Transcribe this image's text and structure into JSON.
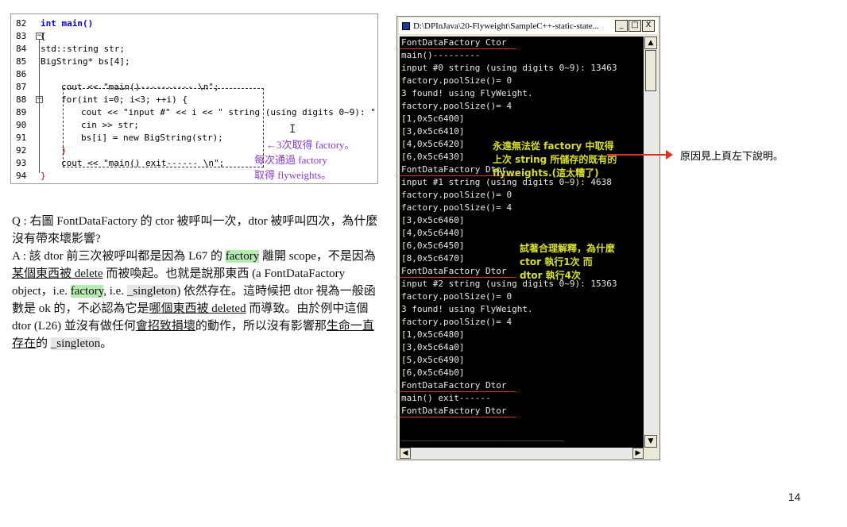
{
  "code": {
    "lines": [
      {
        "n": "82",
        "text": "int main()"
      },
      {
        "n": "83",
        "text": "{"
      },
      {
        "n": "84",
        "text": "std::string str;"
      },
      {
        "n": "85",
        "text": "BigString* bs[4];"
      },
      {
        "n": "86",
        "text": ""
      },
      {
        "n": "87",
        "text": "cout << \"main()---------- \\n\";"
      },
      {
        "n": "88",
        "text": "for(int i=0; i<3; ++i) {"
      },
      {
        "n": "89",
        "text": "cout << \"input #\" << i << \" string (using digits 0~9): \";"
      },
      {
        "n": "90",
        "text": "cin >> str;"
      },
      {
        "n": "91",
        "text": "bs[i] = new BigString(str);"
      },
      {
        "n": "92",
        "text": "}"
      },
      {
        "n": "93",
        "text": "cout << \"main() exit------ \\n\";"
      },
      {
        "n": "94",
        "text": "}"
      }
    ],
    "note_lines": [
      "←3次取得 factory。",
      "每次通過 factory",
      "取得 flyweights。"
    ]
  },
  "qa": {
    "q": "Q : 右圖 FontDataFactory 的 ctor 被呼叫一次，dtor 被呼叫四次，為什麼沒有帶來壞影響?",
    "a_parts": [
      "A : 該 dtor 前三次被呼叫都是因為 L67 的 ",
      "factory",
      " 離開 scope，不是因為",
      "某個東西被 delete",
      " 而被喚起。也就是說那東西 (a FontDataFactory object，i.e. ",
      "factory",
      ", i.e. ",
      "_singleton",
      ") 依然存在。這時候把 dtor 視為一般函數是 ok 的，不必認為它是",
      "哪個東西被 deleted",
      " 而導致。由於例中這個 dtor (L26) 並沒有做任何",
      "會招致損壞",
      "的動作，所以沒有影響那",
      "生命一直存在",
      "的 ",
      "_singleton",
      "。"
    ]
  },
  "console": {
    "title": "D:\\DPInJava\\20-Flyweight\\SampleC++-static-state...",
    "min_btn": "_",
    "max_btn": "□",
    "close_btn": "X",
    "lines": [
      "FontDataFactory Ctor",
      "main()---------",
      "input #0 string (using digits 0~9): 13463",
      "factory.poolSize()= 0",
      "3 found! using FlyWeight.",
      "factory.poolSize()= 4",
      "[1,0x5c6400]",
      "[3,0x5c6410]",
      "[4,0x5c6420]",
      "[6,0x5c6430]",
      "FontDataFactory Dtor",
      "input #1 string (using digits 0~9): 4638",
      "factory.poolSize()= 0",
      "factory.poolSize()= 4",
      "[3,0x5c6460]",
      "[4,0x5c6440]",
      "[6,0x5c6450]",
      "[8,0x5c6470]",
      "FontDataFactory Dtor",
      "input #2 string (using digits 0~9): 15363",
      "factory.poolSize()= 0",
      "3 found! using FlyWeight.",
      "factory.poolSize()= 4",
      "[1,0x5c6480]",
      "[3,0x5c64a0]",
      "[5,0x5c6490]",
      "[6,0x5c64b0]",
      "FontDataFactory Dtor",
      "main() exit------",
      "FontDataFactory Dtor",
      "",
      "_______________________________"
    ],
    "note1": [
      "永遠無法從 factory 中取得",
      "上次 string 所儲存的既有的",
      "flyweights.(這太糟了)"
    ],
    "note2": [
      "試著合理解釋，為什麼",
      "ctor 執行1次 而",
      "dtor 執行4次"
    ]
  },
  "side_note": "原因見上頁左下說明。",
  "page_number": "14",
  "colors": {
    "accent_red": "#e03020",
    "note_yellow": "#d8e022",
    "note_purple": "#8a3bd0",
    "highlight_green": "#b6eab0"
  }
}
